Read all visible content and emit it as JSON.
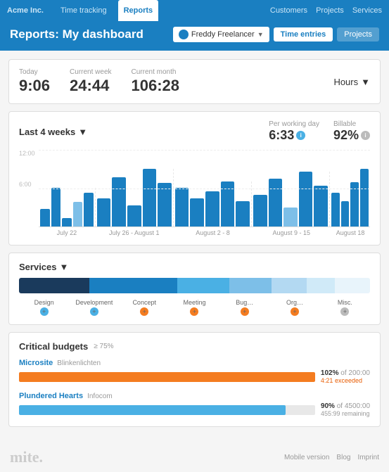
{
  "app": {
    "title": "Acme Inc.",
    "logo": "mite."
  },
  "topnav": {
    "left": [
      {
        "label": "Time tracking",
        "active": false
      },
      {
        "label": "Reports",
        "active": true
      }
    ],
    "right": [
      {
        "label": "Customers"
      },
      {
        "label": "Projects"
      },
      {
        "label": "Services"
      }
    ]
  },
  "header": {
    "title": "Reports: My dashboard",
    "user_label": "Freddy Freelancer",
    "btn_time_entries": "Time entries",
    "btn_projects": "Projects"
  },
  "stats": {
    "today_label": "Today",
    "today_value": "9:06",
    "week_label": "Current week",
    "week_value": "24:44",
    "month_label": "Current month",
    "month_value": "106:28",
    "hours_label": "Hours"
  },
  "chart": {
    "title": "Last 4 weeks",
    "per_working_day_label": "Per working day",
    "per_working_day_value": "6:33",
    "billable_label": "Billable",
    "billable_value": "92%",
    "y_labels": [
      "12:00",
      "6:00"
    ],
    "x_labels": [
      "July 22",
      "July 26 - August 1",
      "August 2 - 8",
      "August 9 - 15",
      "August 18"
    ],
    "weeks": [
      {
        "bars": [
          30,
          60,
          15,
          40,
          55
        ]
      },
      {
        "bars": [
          45,
          80,
          35,
          90,
          70
        ]
      },
      {
        "bars": [
          60,
          45,
          55,
          70,
          40
        ]
      },
      {
        "bars": [
          50,
          75,
          30,
          85,
          65
        ]
      },
      {
        "bars": [
          55,
          40,
          70,
          90,
          0
        ]
      }
    ]
  },
  "services": {
    "title": "Services",
    "segments": [
      {
        "label": "Design",
        "color": "#1a3a5c",
        "width": "20%"
      },
      {
        "label": "Development",
        "color": "#1a7fc1",
        "width": "25%"
      },
      {
        "label": "Concept",
        "color": "#4ab0e4",
        "width": "15%"
      },
      {
        "label": "Meeting",
        "color": "#7dbfe8",
        "width": "12%"
      },
      {
        "label": "Bug…",
        "color": "#b3d9f2",
        "width": "10%"
      },
      {
        "label": "Org…",
        "color": "#d0eaf8",
        "width": "8%"
      },
      {
        "label": "Misc.",
        "color": "#e8f4fb",
        "width": "10%"
      }
    ],
    "dot_colors": [
      "#4ab0e4",
      "#4ab0e4",
      "#f47c20",
      "#f47c20",
      "#f47c20",
      "#f47c20",
      "#bbb"
    ]
  },
  "budgets": {
    "title": "Critical budgets",
    "threshold": "≥ 75%",
    "items": [
      {
        "project": "Microsite",
        "client": "Blinkenlichten",
        "percent": 102,
        "bar_width": "100%",
        "bar_color": "orange",
        "info_percent": "102%",
        "info_of": "of 200:00",
        "info_sub": "4:21 exceeded",
        "info_sub_class": "exceeded"
      },
      {
        "project": "Plundered Hearts",
        "client": "Infocom",
        "percent": 90,
        "bar_width": "90%",
        "bar_color": "blue",
        "info_percent": "90%",
        "info_of": "of 4500:00",
        "info_sub": "455:99 remaining",
        "info_sub_class": "remaining"
      }
    ]
  },
  "footer": {
    "logo": "mite.",
    "links": [
      "Mobile version",
      "Blog",
      "Imprint"
    ]
  }
}
